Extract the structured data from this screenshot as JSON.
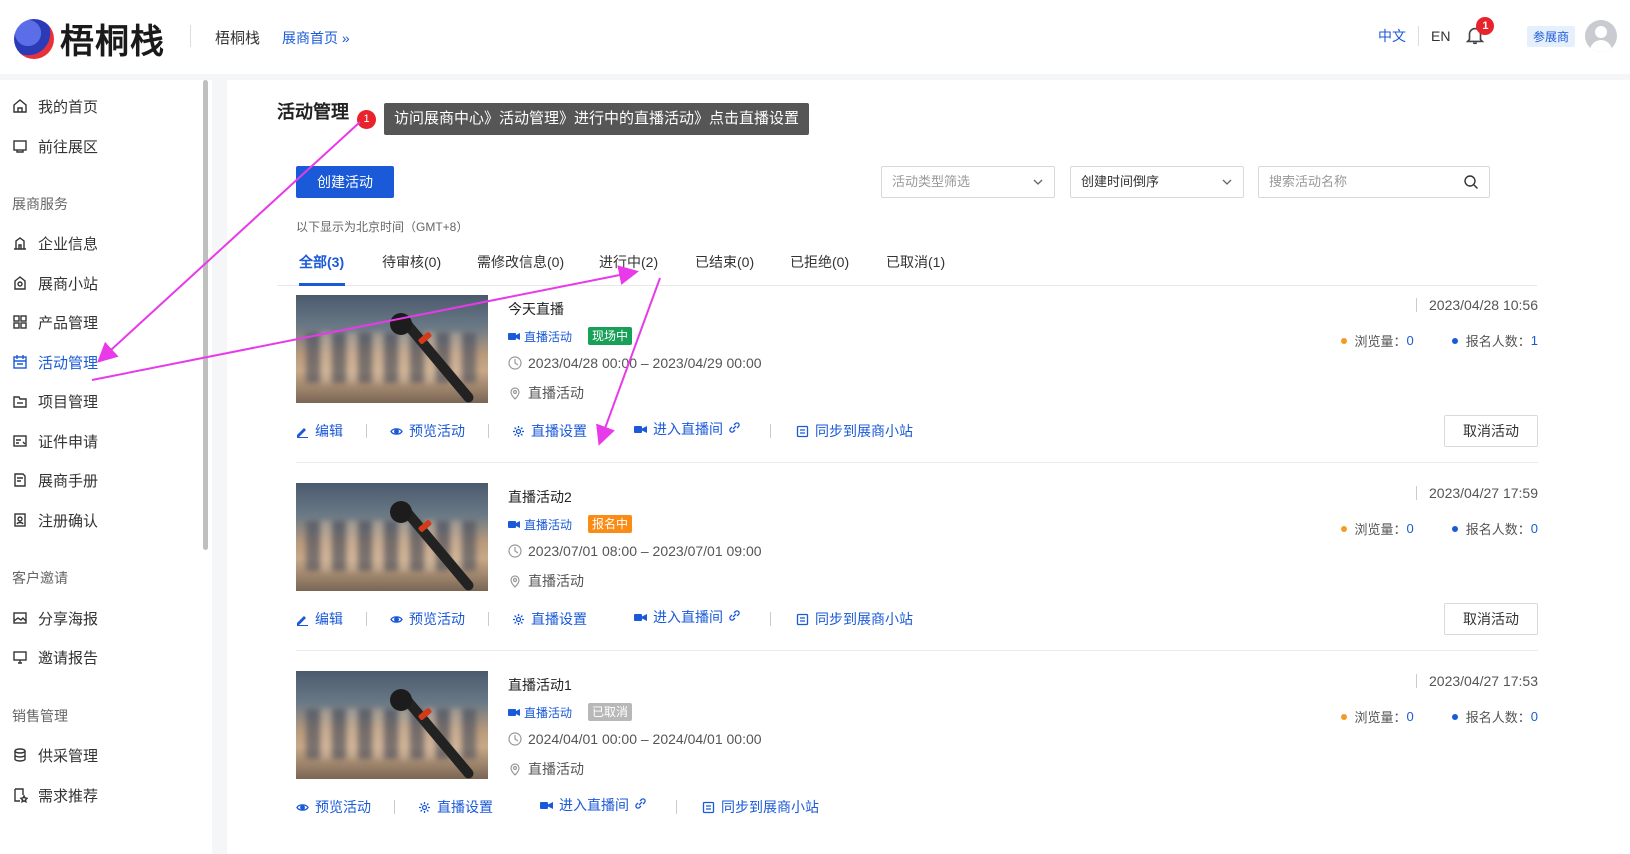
{
  "header": {
    "logo_text": "梧桐栈",
    "site_name": "梧桐栈",
    "home_link": "展商首页 »",
    "lang_cn": "中文",
    "lang_en": "EN",
    "notification_count": "1",
    "role_tag": "参展商"
  },
  "sidebar": {
    "items_top": [
      {
        "label": "我的首页",
        "icon": "home-icon"
      },
      {
        "label": "前往展区",
        "icon": "exhibit-icon"
      }
    ],
    "group_exhibitor": "展商服务",
    "items_exhibitor": [
      {
        "label": "企业信息",
        "icon": "building-icon"
      },
      {
        "label": "展商小站",
        "icon": "store-icon"
      },
      {
        "label": "产品管理",
        "icon": "grid-icon"
      },
      {
        "label": "活动管理",
        "icon": "calendar-icon",
        "active": true
      },
      {
        "label": "项目管理",
        "icon": "folder-icon"
      },
      {
        "label": "证件申请",
        "icon": "badge-icon"
      },
      {
        "label": "展商手册",
        "icon": "manual-icon"
      },
      {
        "label": "注册确认",
        "icon": "confirm-icon"
      }
    ],
    "group_customer": "客户邀请",
    "items_customer": [
      {
        "label": "分享海报",
        "icon": "image-icon"
      },
      {
        "label": "邀请报告",
        "icon": "monitor-icon"
      }
    ],
    "group_sales": "销售管理",
    "items_sales": [
      {
        "label": "供采管理",
        "icon": "database-icon"
      },
      {
        "label": "需求推荐",
        "icon": "star-doc-icon"
      }
    ]
  },
  "main": {
    "title": "活动管理",
    "create_button": "创建活动",
    "filter_type_placeholder": "活动类型筛选",
    "sort_value": "创建时间倒序",
    "search_placeholder": "搜索活动名称",
    "timezone_note": "以下显示为北京时间（GMT+8）",
    "tabs": [
      "全部(3)",
      "待审核(0)",
      "需修改信息(0)",
      "进行中(2)",
      "已结束(0)",
      "已拒绝(0)",
      "已取消(1)"
    ],
    "active_tab": "全部(3)"
  },
  "activities": [
    {
      "title": "今天直播",
      "type": "直播活动",
      "status": "现场中",
      "status_color": "#18a058",
      "time_range": "2023/04/28 00:00 – 2023/04/29 00:00",
      "location": "直播活动",
      "created": "2023/04/28 10:56",
      "views_label": "浏览量：",
      "views": "0",
      "signups_label": "报名人数：",
      "signups": "1",
      "actions": [
        "编辑",
        "预览活动",
        "直播设置",
        "进入直播间",
        "同步到展商小站"
      ],
      "cancel": "取消活动"
    },
    {
      "title": "直播活动2",
      "type": "直播活动",
      "status": "报名中",
      "status_color": "#fa8c16",
      "time_range": "2023/07/01 08:00 – 2023/07/01 09:00",
      "location": "直播活动",
      "created": "2023/04/27 17:59",
      "views_label": "浏览量：",
      "views": "0",
      "signups_label": "报名人数：",
      "signups": "0",
      "actions": [
        "编辑",
        "预览活动",
        "直播设置",
        "进入直播间",
        "同步到展商小站"
      ],
      "cancel": "取消活动"
    },
    {
      "title": "直播活动1",
      "type": "直播活动",
      "status": "已取消",
      "status_color": "#b8b8b8",
      "time_range": "2024/04/01 00:00 – 2024/04/01 00:00",
      "location": "直播活动",
      "created": "2023/04/27 17:53",
      "views_label": "浏览量：",
      "views": "0",
      "signups_label": "报名人数：",
      "signups": "0",
      "actions": [
        "预览活动",
        "直播设置",
        "进入直播间",
        "同步到展商小站"
      ]
    }
  ],
  "annotation": {
    "step": "1",
    "text": "访问展商中心》活动管理》进行中的直播活动》点击直播设置",
    "arrow_color": "#e83ae8"
  },
  "colors": {
    "accent": "#1a5ad8",
    "views_dot": "#f59a23",
    "signups_dot": "#1a5ad8"
  }
}
